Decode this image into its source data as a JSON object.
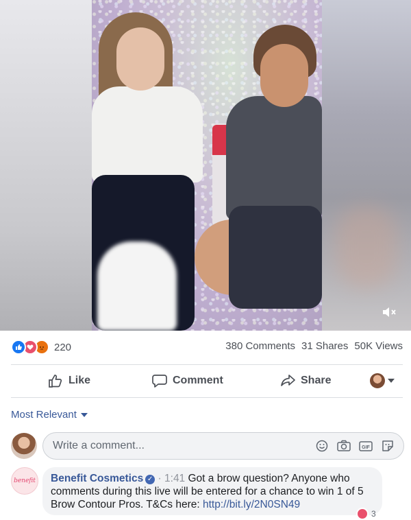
{
  "video": {
    "mute_icon": "speaker-muted-icon"
  },
  "stats": {
    "reaction_icons": [
      "like-icon",
      "love-icon",
      "angry-icon"
    ],
    "reaction_count": "220",
    "comments": "380 Comments",
    "shares": "31 Shares",
    "views": "50K Views"
  },
  "actions": {
    "like": "Like",
    "comment": "Comment",
    "share": "Share"
  },
  "sort": {
    "label": "Most Relevant"
  },
  "composer": {
    "placeholder": "Write a comment..."
  },
  "comment": {
    "avatar_text": "benefit",
    "author": "Benefit Cosmetics",
    "timestamp": "· 1:41",
    "text": "Got a brow question? Anyone who comments during this live will be entered for a chance to win 1 of 5 Brow Contour Pros. T&Cs here:",
    "link": "http://bit.ly/2N0SN49",
    "reaction_count": "3"
  },
  "colors": {
    "link": "#385898",
    "like_blue": "#1877f2",
    "love_red": "#e9506c",
    "angry_orange": "#e9710f",
    "muted_text": "#4b4f56"
  }
}
